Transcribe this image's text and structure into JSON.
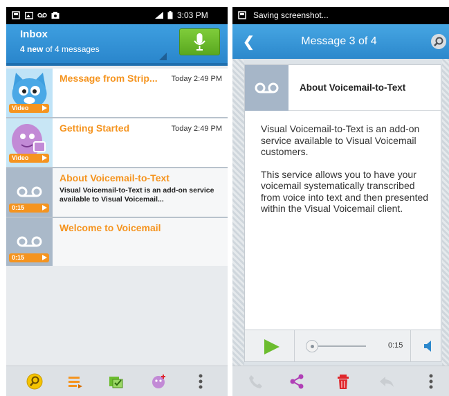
{
  "left": {
    "status_time": "3:03 PM",
    "inbox": {
      "title": "Inbox",
      "new_count": "4 new",
      "sub_rest": " of 4 messages"
    },
    "messages": [
      {
        "title": "Message from Strip...",
        "time": "Today 2:49 PM",
        "body": "",
        "badge": "Video",
        "kind": "video"
      },
      {
        "title": "Getting Started",
        "time": "Today 2:49 PM",
        "body": "",
        "badge": "Video",
        "kind": "video"
      },
      {
        "title": "About Voicemail-to-Text",
        "time": "",
        "body": "Visual Voicemail-to-Text is an add-on service available to Visual Voicemail...",
        "badge": "0:15",
        "kind": "voicemail"
      },
      {
        "title": "Welcome to Voicemail",
        "time": "",
        "body": "",
        "badge": "0:15",
        "kind": "voicemail"
      }
    ],
    "bottom_icons": [
      "search-icon",
      "list-icon",
      "select-all-icon",
      "add-contact-icon",
      "more-icon"
    ]
  },
  "right": {
    "status_text": "Saving screenshot...",
    "header": {
      "back": "❮",
      "title": "Message 3 of 4"
    },
    "card": {
      "title": "About Voicemail-to-Text",
      "paragraph1": "Visual Voicemail-to-Text is an add-on service available to Visual Voicemail customers.",
      "paragraph2": "This service allows you to have your voicemail systematically transcribed from voice into text and then presented within the Visual Voicemail client."
    },
    "player": {
      "duration": "0:15"
    },
    "bottom_icons": [
      "call-icon",
      "share-icon",
      "delete-icon",
      "reply-icon",
      "more-icon"
    ]
  },
  "colors": {
    "accent_blue": "#2a86cc",
    "title_orange": "#f5941f",
    "play_green": "#6cbd2f",
    "delete_red": "#e0262b",
    "share_purple": "#b03fb6"
  }
}
